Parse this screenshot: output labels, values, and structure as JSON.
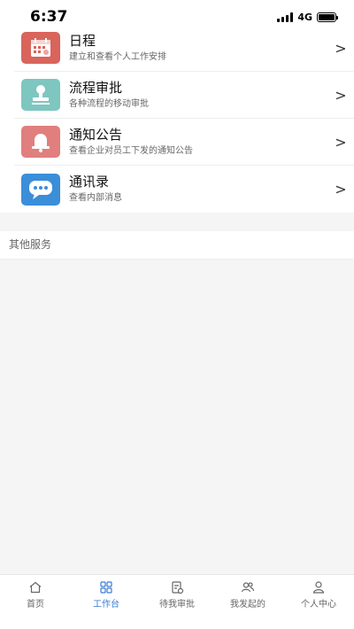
{
  "status_bar": {
    "time": "6:37",
    "network": "4G"
  },
  "menu_items": [
    {
      "title": "日程",
      "subtitle": "建立和查看个人工作安排",
      "icon": "calendar-icon",
      "color": "#d9645c"
    },
    {
      "title": "流程审批",
      "subtitle": "各种流程的移动审批",
      "icon": "stamp-icon",
      "color": "#7ec6c0"
    },
    {
      "title": "通知公告",
      "subtitle": "查看企业对员工下发的通知公告",
      "icon": "bell-icon",
      "color": "#e07f7d"
    },
    {
      "title": "通讯录",
      "subtitle": "查看内部消息",
      "icon": "chat-bubble-icon",
      "color": "#3b8ed8"
    }
  ],
  "chevron": ">",
  "section": {
    "label": "其他服务"
  },
  "tabs": [
    {
      "label": "首页",
      "icon": "home-icon",
      "active": false
    },
    {
      "label": "工作台",
      "icon": "grid-icon",
      "active": true
    },
    {
      "label": "待我审批",
      "icon": "approval-icon",
      "active": false
    },
    {
      "label": "我发起的",
      "icon": "users-icon",
      "active": false
    },
    {
      "label": "个人中心",
      "icon": "person-icon",
      "active": false
    }
  ],
  "colors": {
    "accent": "#3a7bd5",
    "background": "#f5f5f5"
  }
}
